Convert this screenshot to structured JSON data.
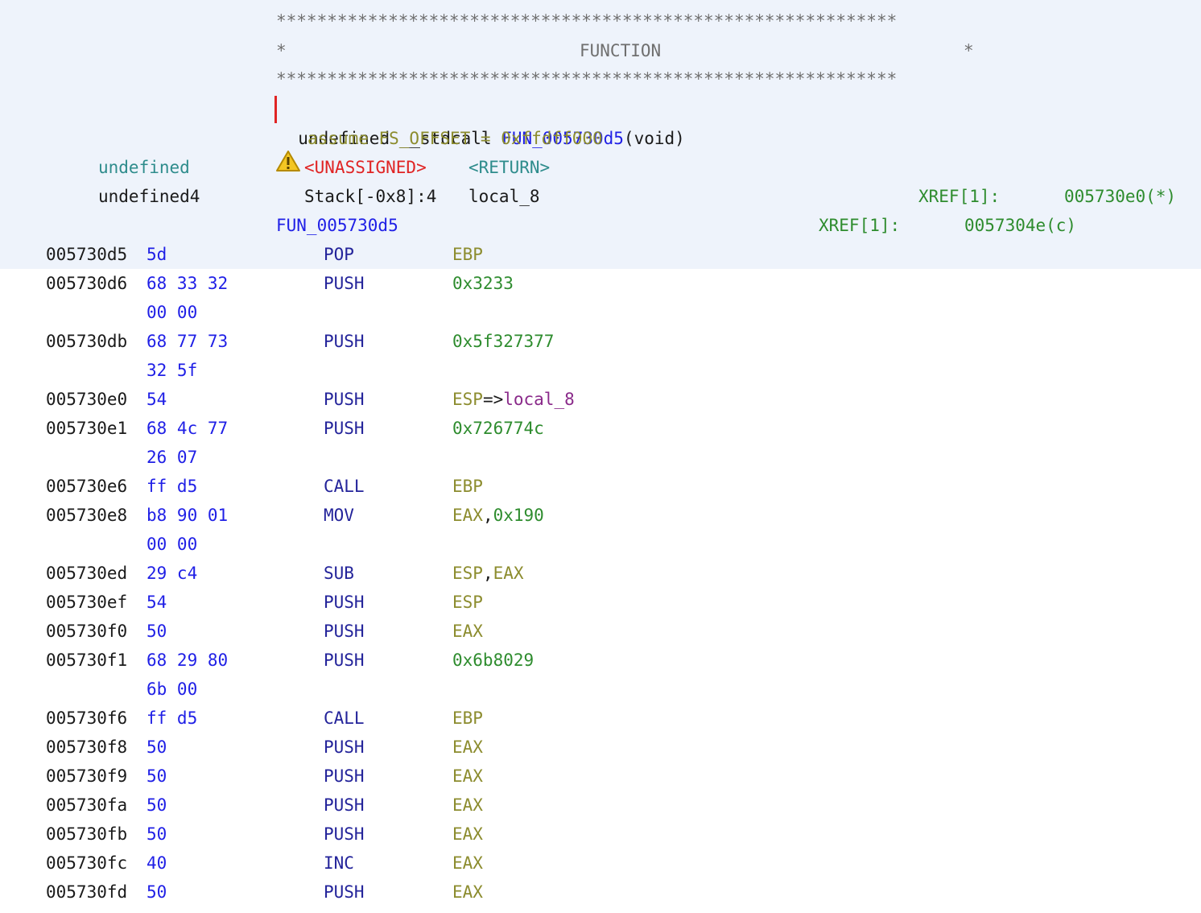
{
  "header": {
    "stars_line": "*************************************************************",
    "star_left": "*",
    "star_right": "*",
    "function_label": "FUNCTION",
    "sig_return_type": "undefined",
    "sig_callconv": "__stdcall",
    "sig_name": "FUN_005730d5",
    "sig_args": "(void)",
    "assume_line": "assume FS_OFFSET = 0xffdff000",
    "ret_type": "undefined",
    "ret_storage": "<UNASSIGNED>",
    "ret_name": "<RETURN>",
    "local_type": "undefined4",
    "local_storage": "Stack[-0x8]:4",
    "local_name": "local_8",
    "local_xref_label": "XREF[1]:",
    "local_xref_value": "005730e0(*)",
    "label_name": "FUN_005730d5",
    "label_xref_label": "XREF[1]:",
    "label_xref_value": "0057304e(c)",
    "icons": {
      "warning": "warning-icon"
    }
  },
  "listing": [
    {
      "addr": "005730d5",
      "bytes": "5d",
      "mnem": "POP",
      "ops": [
        {
          "t": "EBP",
          "c": "olive"
        }
      ]
    },
    {
      "addr": "005730d6",
      "bytes": "68 33 32",
      "mnem": "PUSH",
      "ops": [
        {
          "t": "0x3233",
          "c": "green"
        }
      ]
    },
    {
      "addr": "",
      "bytes": "00 00",
      "mnem": "",
      "ops": []
    },
    {
      "addr": "005730db",
      "bytes": "68 77 73",
      "mnem": "PUSH",
      "ops": [
        {
          "t": "0x5f327377",
          "c": "green"
        }
      ]
    },
    {
      "addr": "",
      "bytes": "32 5f",
      "mnem": "",
      "ops": []
    },
    {
      "addr": "005730e0",
      "bytes": "54",
      "mnem": "PUSH",
      "ops": [
        {
          "t": "ESP",
          "c": "olive"
        },
        {
          "t": "=>",
          "c": "black"
        },
        {
          "t": "local_8",
          "c": "purple"
        }
      ]
    },
    {
      "addr": "005730e1",
      "bytes": "68 4c 77",
      "mnem": "PUSH",
      "ops": [
        {
          "t": "0x726774c",
          "c": "green"
        }
      ]
    },
    {
      "addr": "",
      "bytes": "26 07",
      "mnem": "",
      "ops": []
    },
    {
      "addr": "005730e6",
      "bytes": "ff d5",
      "mnem": "CALL",
      "ops": [
        {
          "t": "EBP",
          "c": "olive"
        }
      ]
    },
    {
      "addr": "005730e8",
      "bytes": "b8 90 01",
      "mnem": "MOV",
      "ops": [
        {
          "t": "EAX",
          "c": "olive"
        },
        {
          "t": ",",
          "c": "black"
        },
        {
          "t": "0x190",
          "c": "green"
        }
      ]
    },
    {
      "addr": "",
      "bytes": "00 00",
      "mnem": "",
      "ops": []
    },
    {
      "addr": "005730ed",
      "bytes": "29 c4",
      "mnem": "SUB",
      "ops": [
        {
          "t": "ESP",
          "c": "olive"
        },
        {
          "t": ",",
          "c": "black"
        },
        {
          "t": "EAX",
          "c": "olive"
        }
      ]
    },
    {
      "addr": "005730ef",
      "bytes": "54",
      "mnem": "PUSH",
      "ops": [
        {
          "t": "ESP",
          "c": "olive"
        }
      ]
    },
    {
      "addr": "005730f0",
      "bytes": "50",
      "mnem": "PUSH",
      "ops": [
        {
          "t": "EAX",
          "c": "olive"
        }
      ]
    },
    {
      "addr": "005730f1",
      "bytes": "68 29 80",
      "mnem": "PUSH",
      "ops": [
        {
          "t": "0x6b8029",
          "c": "green"
        }
      ]
    },
    {
      "addr": "",
      "bytes": "6b 00",
      "mnem": "",
      "ops": []
    },
    {
      "addr": "005730f6",
      "bytes": "ff d5",
      "mnem": "CALL",
      "ops": [
        {
          "t": "EBP",
          "c": "olive"
        }
      ]
    },
    {
      "addr": "005730f8",
      "bytes": "50",
      "mnem": "PUSH",
      "ops": [
        {
          "t": "EAX",
          "c": "olive"
        }
      ]
    },
    {
      "addr": "005730f9",
      "bytes": "50",
      "mnem": "PUSH",
      "ops": [
        {
          "t": "EAX",
          "c": "olive"
        }
      ]
    },
    {
      "addr": "005730fa",
      "bytes": "50",
      "mnem": "PUSH",
      "ops": [
        {
          "t": "EAX",
          "c": "olive"
        }
      ]
    },
    {
      "addr": "005730fb",
      "bytes": "50",
      "mnem": "PUSH",
      "ops": [
        {
          "t": "EAX",
          "c": "olive"
        }
      ]
    },
    {
      "addr": "005730fc",
      "bytes": "40",
      "mnem": "INC",
      "ops": [
        {
          "t": "EAX",
          "c": "olive"
        }
      ]
    },
    {
      "addr": "005730fd",
      "bytes": "50",
      "mnem": "PUSH",
      "ops": [
        {
          "t": "EAX",
          "c": "olive"
        }
      ]
    }
  ],
  "colors": {
    "highlight_bg": "#eef3fb",
    "cursor": "#e02424",
    "keyword_blue": "#1f1fe6",
    "register_olive": "#8c8c2e",
    "scalar_green": "#2e8c2e",
    "type_teal": "#2e8c8c",
    "mnemonic_navy": "#23239a",
    "variable_purple": "#8a2a8a"
  }
}
